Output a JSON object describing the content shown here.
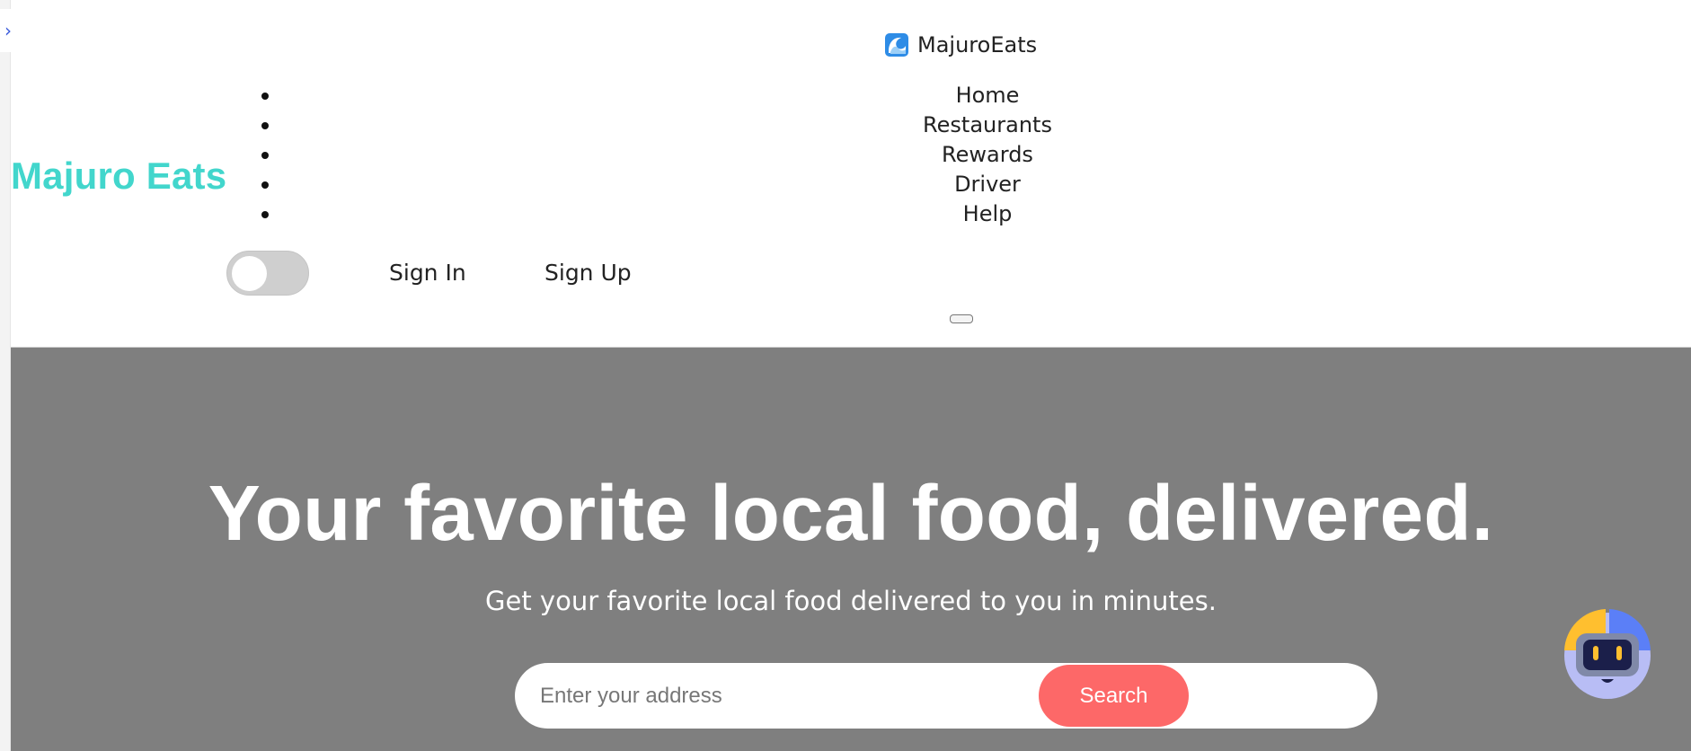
{
  "app": {
    "name": "MajuroEats",
    "logo_icon": "wave-icon"
  },
  "site": {
    "logo_text": "Majuro Eats",
    "accent_color": "#42d6cc"
  },
  "sidebar_toggle": {
    "icon": "chevron-right-icon",
    "glyph": "›"
  },
  "nav": {
    "items": [
      {
        "label": "Home"
      },
      {
        "label": "Restaurants"
      },
      {
        "label": "Rewards"
      },
      {
        "label": "Driver"
      },
      {
        "label": "Help"
      }
    ]
  },
  "theme_toggle": {
    "state": "off"
  },
  "auth": {
    "sign_in": "Sign In",
    "sign_up": "Sign Up"
  },
  "hero": {
    "title": "Your favorite local food, delivered.",
    "subtitle": "Get your favorite local food delivered to you in minutes.",
    "background_color": "#7f7f7f"
  },
  "search": {
    "placeholder": "Enter your address",
    "value": "",
    "button_label": "Search",
    "button_color": "#fd6868"
  },
  "chat_widget": {
    "icon": "robot-icon"
  }
}
